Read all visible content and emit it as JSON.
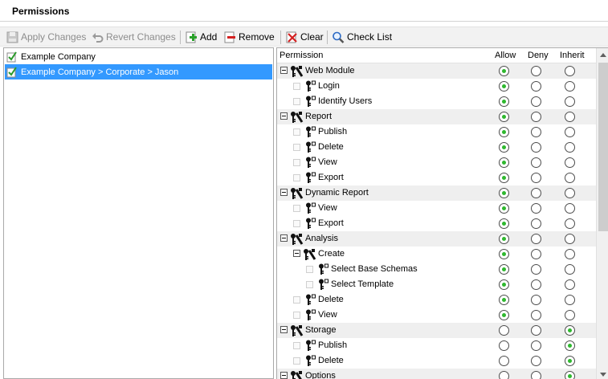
{
  "header": {
    "title": "Permissions"
  },
  "toolbar": {
    "apply_label": "Apply Changes",
    "revert_label": "Revert Changes",
    "add_label": "Add",
    "remove_label": "Remove",
    "clear_label": "Clear",
    "checklist_label": "Check List"
  },
  "left_list": [
    {
      "label": "Example Company",
      "selected": false
    },
    {
      "label": "Example Company > Corporate > Jason",
      "selected": true
    }
  ],
  "grid": {
    "columns": {
      "permission": "Permission",
      "allow": "Allow",
      "deny": "Deny",
      "inherit": "Inherit"
    },
    "rows": [
      {
        "label": "Web Module",
        "level": 0,
        "group": true,
        "value": "allow"
      },
      {
        "label": "Login",
        "level": 1,
        "group": false,
        "value": "allow"
      },
      {
        "label": "Identify Users",
        "level": 1,
        "group": false,
        "value": "allow"
      },
      {
        "label": "Report",
        "level": 0,
        "group": true,
        "value": "allow"
      },
      {
        "label": "Publish",
        "level": 1,
        "group": false,
        "value": "allow"
      },
      {
        "label": "Delete",
        "level": 1,
        "group": false,
        "value": "allow"
      },
      {
        "label": "View",
        "level": 1,
        "group": false,
        "value": "allow"
      },
      {
        "label": "Export",
        "level": 1,
        "group": false,
        "value": "allow"
      },
      {
        "label": "Dynamic Report",
        "level": 0,
        "group": true,
        "value": "allow"
      },
      {
        "label": "View",
        "level": 1,
        "group": false,
        "value": "allow"
      },
      {
        "label": "Export",
        "level": 1,
        "group": false,
        "value": "allow"
      },
      {
        "label": "Analysis",
        "level": 0,
        "group": true,
        "value": "allow"
      },
      {
        "label": "Create",
        "level": 1,
        "group": true,
        "value": "allow"
      },
      {
        "label": "Select Base Schemas",
        "level": 2,
        "group": false,
        "value": "allow"
      },
      {
        "label": "Select Template",
        "level": 2,
        "group": false,
        "value": "allow"
      },
      {
        "label": "Delete",
        "level": 1,
        "group": false,
        "value": "allow"
      },
      {
        "label": "View",
        "level": 1,
        "group": false,
        "value": "allow"
      },
      {
        "label": "Storage",
        "level": 0,
        "group": true,
        "value": "inherit"
      },
      {
        "label": "Publish",
        "level": 1,
        "group": false,
        "value": "inherit"
      },
      {
        "label": "Delete",
        "level": 1,
        "group": false,
        "value": "inherit"
      },
      {
        "label": "Options",
        "level": 0,
        "group": true,
        "value": "inherit"
      }
    ]
  },
  "colors": {
    "selection": "#3399ff",
    "radio_on": "#2eb82e",
    "group_row": "#efefef"
  }
}
